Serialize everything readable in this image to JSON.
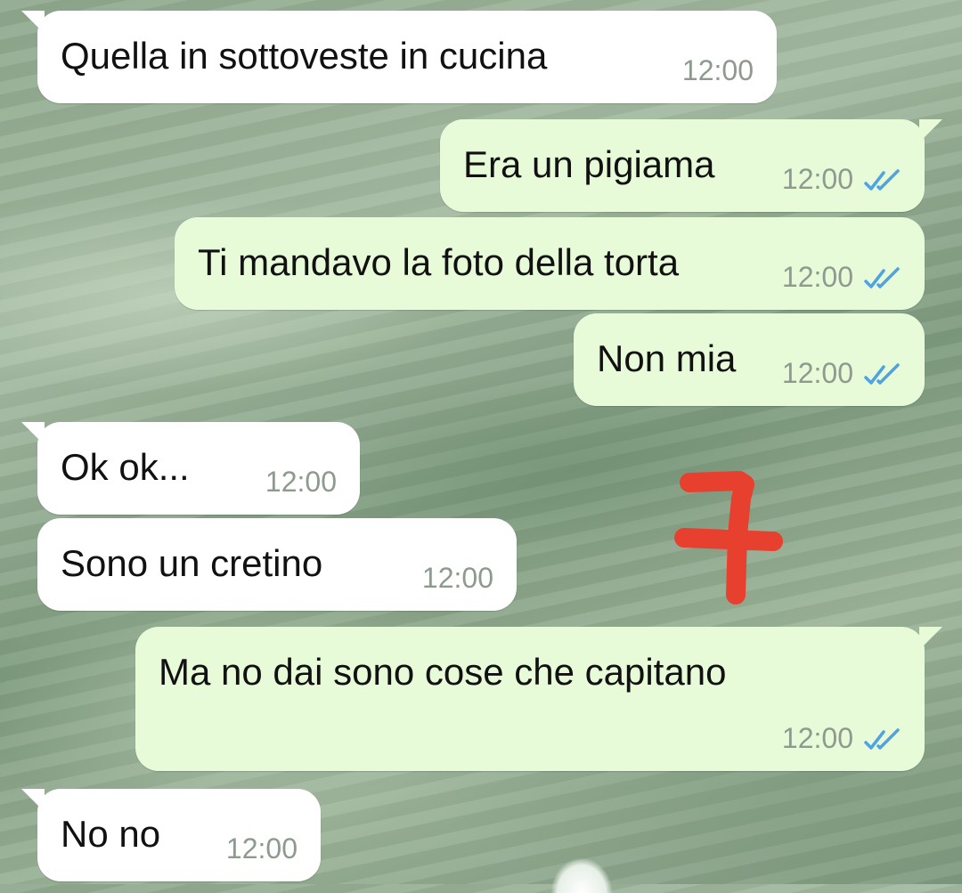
{
  "messages": [
    {
      "direction": "incoming",
      "text": "Quella in sottoveste in cucina",
      "time": "12:00"
    },
    {
      "direction": "outgoing",
      "text": "Era un pigiama",
      "time": "12:00",
      "status": "read"
    },
    {
      "direction": "outgoing",
      "text": "Ti mandavo la foto della torta",
      "time": "12:00",
      "status": "read"
    },
    {
      "direction": "outgoing",
      "text": "Non mia",
      "time": "12:00",
      "status": "read"
    },
    {
      "direction": "incoming",
      "text": "Ok ok...",
      "time": "12:00"
    },
    {
      "direction": "incoming",
      "text": "Sono un cretino",
      "time": "12:00"
    },
    {
      "direction": "outgoing",
      "text": "Ma no dai sono cose che capitano",
      "time": "12:00",
      "status": "read"
    },
    {
      "direction": "incoming",
      "text": "No no",
      "time": "12:00"
    }
  ],
  "annotation": {
    "text": "7",
    "color": "#e8402e"
  },
  "colors": {
    "incoming_bubble": "#ffffff",
    "outgoing_bubble": "#e8fbd9",
    "read_ticks": "#4fa3e0",
    "timestamp": "#8e9a8e"
  },
  "icons": {
    "read_receipt": "double-check-icon"
  }
}
